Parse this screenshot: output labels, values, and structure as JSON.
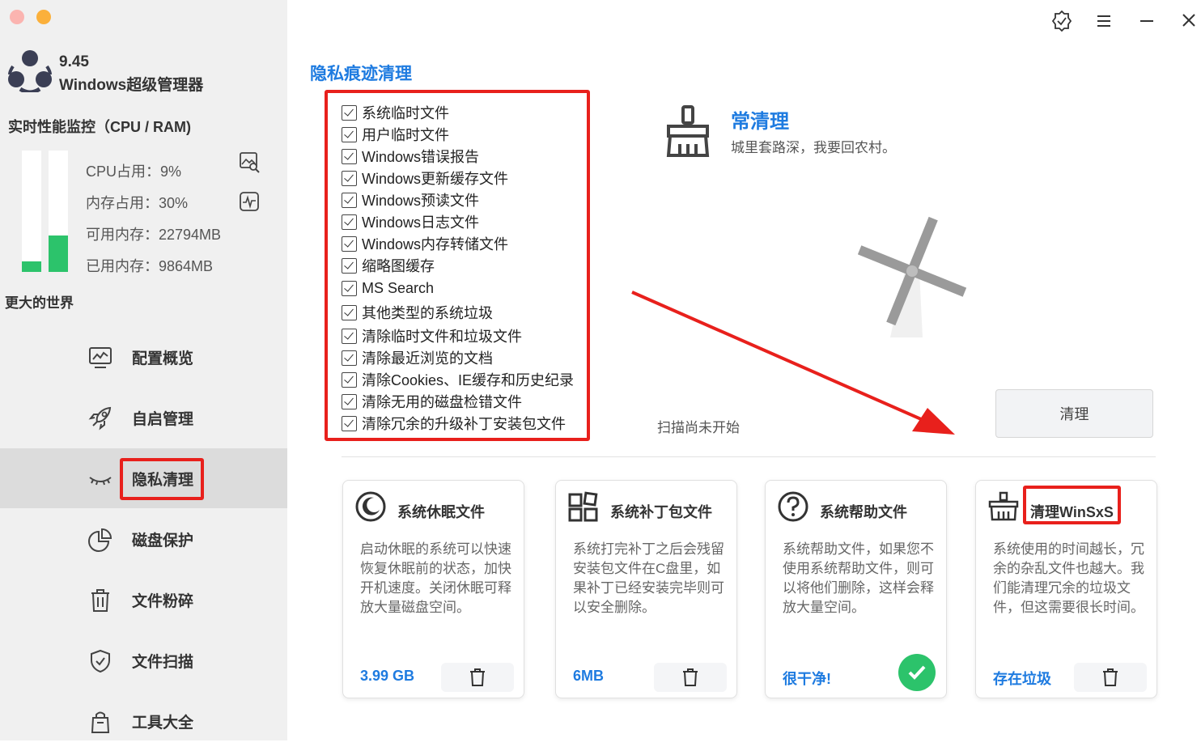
{
  "app": {
    "version": "9.45",
    "name": "Windows超级管理器"
  },
  "sidebar": {
    "perf_title": "实时性能监控（CPU / RAM)",
    "cpu_percent": 9,
    "ram_percent": 30,
    "stats": {
      "cpu": "CPU占用：9%",
      "mem": "内存占用：30%",
      "avail": "可用内存：22794MB",
      "used": "已用内存：9864MB"
    },
    "world": "更大的世界",
    "nav": [
      {
        "label": "配置概览",
        "icon": "monitor-chart-icon"
      },
      {
        "label": "自启管理",
        "icon": "rocket-icon"
      },
      {
        "label": "隐私清理",
        "icon": "closed-eye-icon"
      },
      {
        "label": "磁盘保护",
        "icon": "pie-chart-icon"
      },
      {
        "label": "文件粉碎",
        "icon": "trash-icon"
      },
      {
        "label": "文件扫描",
        "icon": "shield-check-icon"
      },
      {
        "label": "工具大全",
        "icon": "bag-icon"
      }
    ],
    "active_index": 2
  },
  "main": {
    "section_title": "隐私痕迹清理",
    "checklist": [
      "系统临时文件",
      "用户临时文件",
      "Windows错误报告",
      "Windows更新缓存文件",
      "Windows预读文件",
      "Windows日志文件",
      "Windows内存转储文件",
      "缩略图缓存",
      "MS Search",
      "其他类型的系统垃圾",
      "清除临时文件和垃圾文件",
      "清除最近浏览的文档",
      "清除Cookies、IE缓存和历史纪录",
      "清除无用的磁盘检错文件",
      "清除冗余的升级补丁安装包文件"
    ],
    "mode_title": "常清理",
    "mode_desc": "城里套路深，我要回农村。",
    "scan_status": "扫描尚未开始",
    "clean_button": "清理"
  },
  "cards": [
    {
      "title": "系统休眠文件",
      "icon": "moon-icon",
      "desc": "启动休眠的系统可以快速恢复休眠前的状态，加快开机速度。关闭休眠可释放大量磁盘空间。",
      "value": "3.99 GB",
      "action": "trash-icon"
    },
    {
      "title": "系统补丁包文件",
      "icon": "grid-icon",
      "desc": "系统打完补丁之后会残留安装包文件在C盘里，如果补丁已经安装完毕则可以安全删除。",
      "value": "6MB",
      "action": "trash-icon"
    },
    {
      "title": "系统帮助文件",
      "icon": "help-icon",
      "desc": "系统帮助文件，如果您不使用系统帮助文件，则可以将他们删除，这样会释放大量空间。",
      "value": "很干净!",
      "action": "check-icon"
    },
    {
      "title": "清理WinSxS",
      "icon": "basket-icon",
      "desc": "系统使用的时间越长，冗余的杂乱文件也越大。我们能清理冗余的垃圾文件，但这需要很长时间。",
      "value": "存在垃圾",
      "action": "trash-icon"
    }
  ],
  "colors": {
    "accent": "#1e7be0",
    "highlight": "#e8201c",
    "green": "#2cc36b"
  }
}
